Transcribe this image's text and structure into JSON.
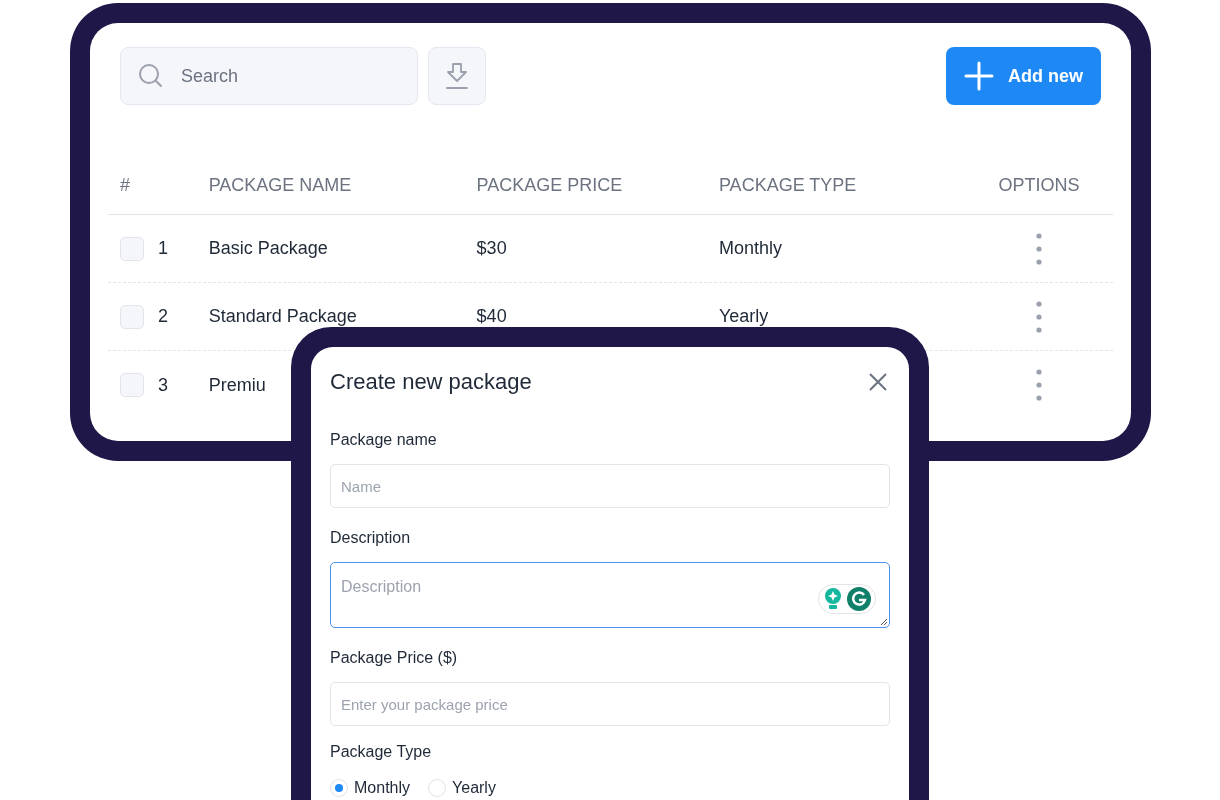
{
  "toolbar": {
    "search": {
      "placeholder": "Search"
    },
    "add_button": "Add new"
  },
  "table": {
    "columns": [
      "#",
      "PACKAGE NAME",
      "PACKAGE PRICE",
      "PACKAGE TYPE",
      "OPTIONS"
    ],
    "rows": [
      {
        "checked": false,
        "number": "1",
        "name": "Basic Package",
        "price": "$30",
        "type": "Monthly"
      },
      {
        "checked": false,
        "number": "2",
        "name": "Standard Package",
        "price": "$40",
        "type": "Yearly"
      },
      {
        "checked": false,
        "number": "3",
        "name": "Premiu",
        "price": "",
        "type": ""
      }
    ]
  },
  "modal": {
    "title": "Create new package",
    "fields": [
      {
        "kind": "input",
        "label": "Package name",
        "placeholder": "Name",
        "focused": false
      },
      {
        "kind": "textarea",
        "label": "Description",
        "placeholder": "Description",
        "focused": true
      },
      {
        "kind": "input",
        "label": "Package Price ($)",
        "placeholder": "Enter your package price",
        "focused": false
      }
    ],
    "type_group": {
      "label": "Package Type",
      "options": [
        {
          "label": "Monthly",
          "selected": true
        },
        {
          "label": "Yearly",
          "selected": false
        }
      ]
    }
  }
}
